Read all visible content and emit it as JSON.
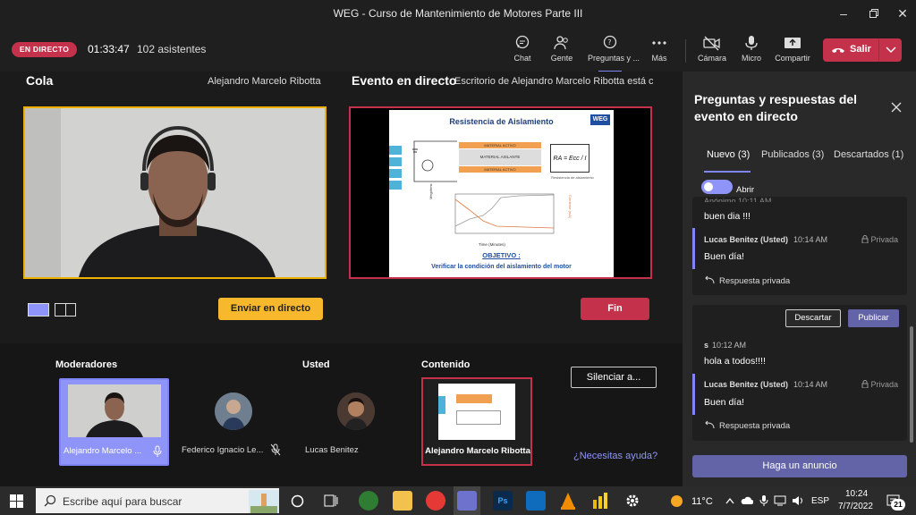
{
  "window": {
    "title": "WEG - Curso de Mantenimiento de Motores Parte III"
  },
  "toolbar": {
    "live_badge": "EN DIRECTO",
    "timer": "01:33:47",
    "attendees": "102 asistentes",
    "chat": "Chat",
    "people": "Gente",
    "qa": "Preguntas y ...",
    "more": "Más",
    "camera": "Cámara",
    "mic": "Micro",
    "share": "Compartir",
    "leave": "Salir"
  },
  "stage": {
    "queue_title": "Cola",
    "queue_presenter": "Alejandro Marcelo Ribotta",
    "live_title": "Evento en directo",
    "live_presenter": "Escritorio de Alejandro Marcelo Ribotta está c",
    "send_live": "Enviar en directo",
    "end": "Fin",
    "slide": {
      "title": "Resistencia de Aislamiento",
      "logo": "WEG",
      "layer1": "MATERIAL ACTIVO",
      "layer2": "MATERIAL AISLANTE",
      "layer3": "MATERIAL ACTIVO",
      "formula": "RA = Ecc / I",
      "formula_caption": "Resistencia de aislamiento",
      "chart_y_label": "Megohms",
      "chart_y2_label": "Corriente (mA)",
      "chart_x_label": "Time (Minutes)",
      "objective_label": "OBJETIVO :",
      "objective_text": "Verificar la condición del aislamiento del motor"
    }
  },
  "bottom": {
    "moderators": "Moderadores",
    "you": "Usted",
    "content": "Contenido",
    "mute_all": "Silenciar a...",
    "help": "¿Necesitas ayuda?",
    "participants": [
      {
        "name": "Alejandro Marcelo ..."
      },
      {
        "name": "Federico Ignacio Le..."
      },
      {
        "name": "Lucas Benitez"
      }
    ],
    "content_name": "Alejandro Marcelo Ribotta"
  },
  "qa": {
    "title": "Preguntas y respuestas del evento en directo",
    "tabs": [
      "Nuevo (3)",
      "Publicados (3)",
      "Descartados (1)"
    ],
    "open_toggle": "Abrir",
    "messages": [
      {
        "author": "Anónimo 10:11 AM",
        "text": "buen dia !!!"
      },
      {
        "author": "Lucas Benitez (Usted)",
        "time": "10:14 AM",
        "privacy": "Privada",
        "text": "Buen día!"
      },
      {
        "reply": "Respuesta privada"
      },
      {
        "author": "s",
        "time": "10:12 AM",
        "text": "hola a todos!!!!"
      },
      {
        "author": "Lucas Benitez (Usted)",
        "time": "10:14 AM",
        "privacy": "Privada",
        "text": "Buen día!"
      },
      {
        "reply": "Respuesta privada"
      }
    ],
    "discard": "Descartar",
    "publish": "Publicar",
    "announce": "Haga un anuncio"
  },
  "taskbar": {
    "search_placeholder": "Escribe aquí para buscar",
    "weather": "11°C",
    "lang": "ESP",
    "time": "10:24",
    "date": "7/7/2022",
    "notifications": "21"
  },
  "colors": {
    "accent": "#6264a7",
    "live": "#c4314b",
    "queue_border": "#f0b000",
    "live_border": "#c4314b",
    "send_btn": "#f8b82b"
  }
}
